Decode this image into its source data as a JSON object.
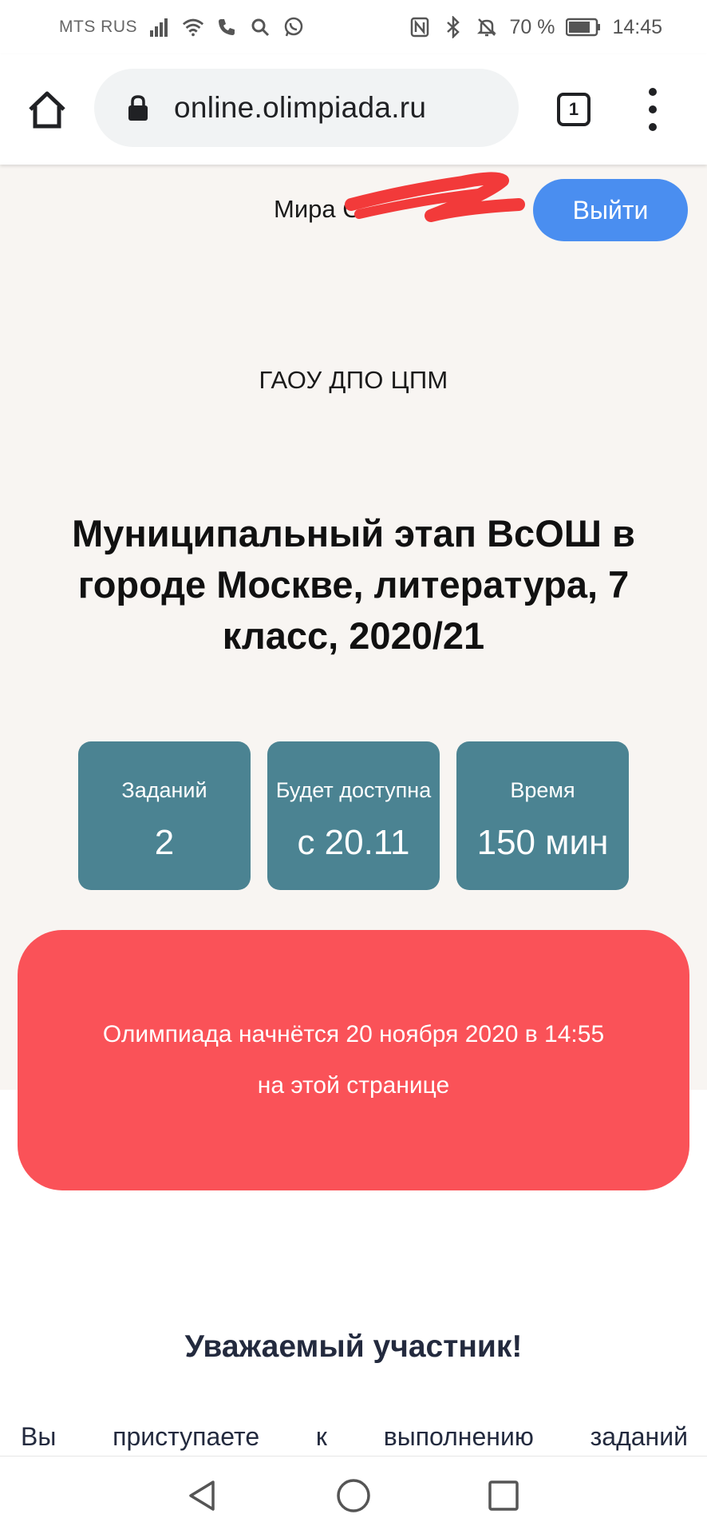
{
  "status_bar": {
    "carrier": "MTS RUS",
    "battery_percent": "70 %",
    "time": "14:45"
  },
  "browser": {
    "url": "online.olimpiada.ru",
    "tab_count": "1"
  },
  "header": {
    "user_name": "Мира С",
    "logout_label": "Выйти"
  },
  "olympiad": {
    "organizer": "ГАОУ ДПО ЦПМ",
    "title": "Муниципальный этап ВсОШ в городе Москве, литература, 7 класс, 2020/21",
    "cards": [
      {
        "label": "Заданий",
        "value": "2"
      },
      {
        "label": "Будет доступна",
        "value": "с 20.11"
      },
      {
        "label": "Время",
        "value": "150 мин"
      }
    ],
    "alert": {
      "line1": "Олимпиада начнётся 20 ноября 2020 в 14:55",
      "line2": "на этой странице"
    }
  },
  "intro": {
    "greeting": "Уважаемый участник!",
    "words": [
      "Вы",
      "приступаете",
      "к",
      "выполнению",
      "заданий"
    ]
  },
  "colors": {
    "logout_button": "#4a8ef0",
    "card_background": "#4b8392",
    "alert_background": "#fa5258",
    "page_background": "#f8f5f2"
  }
}
